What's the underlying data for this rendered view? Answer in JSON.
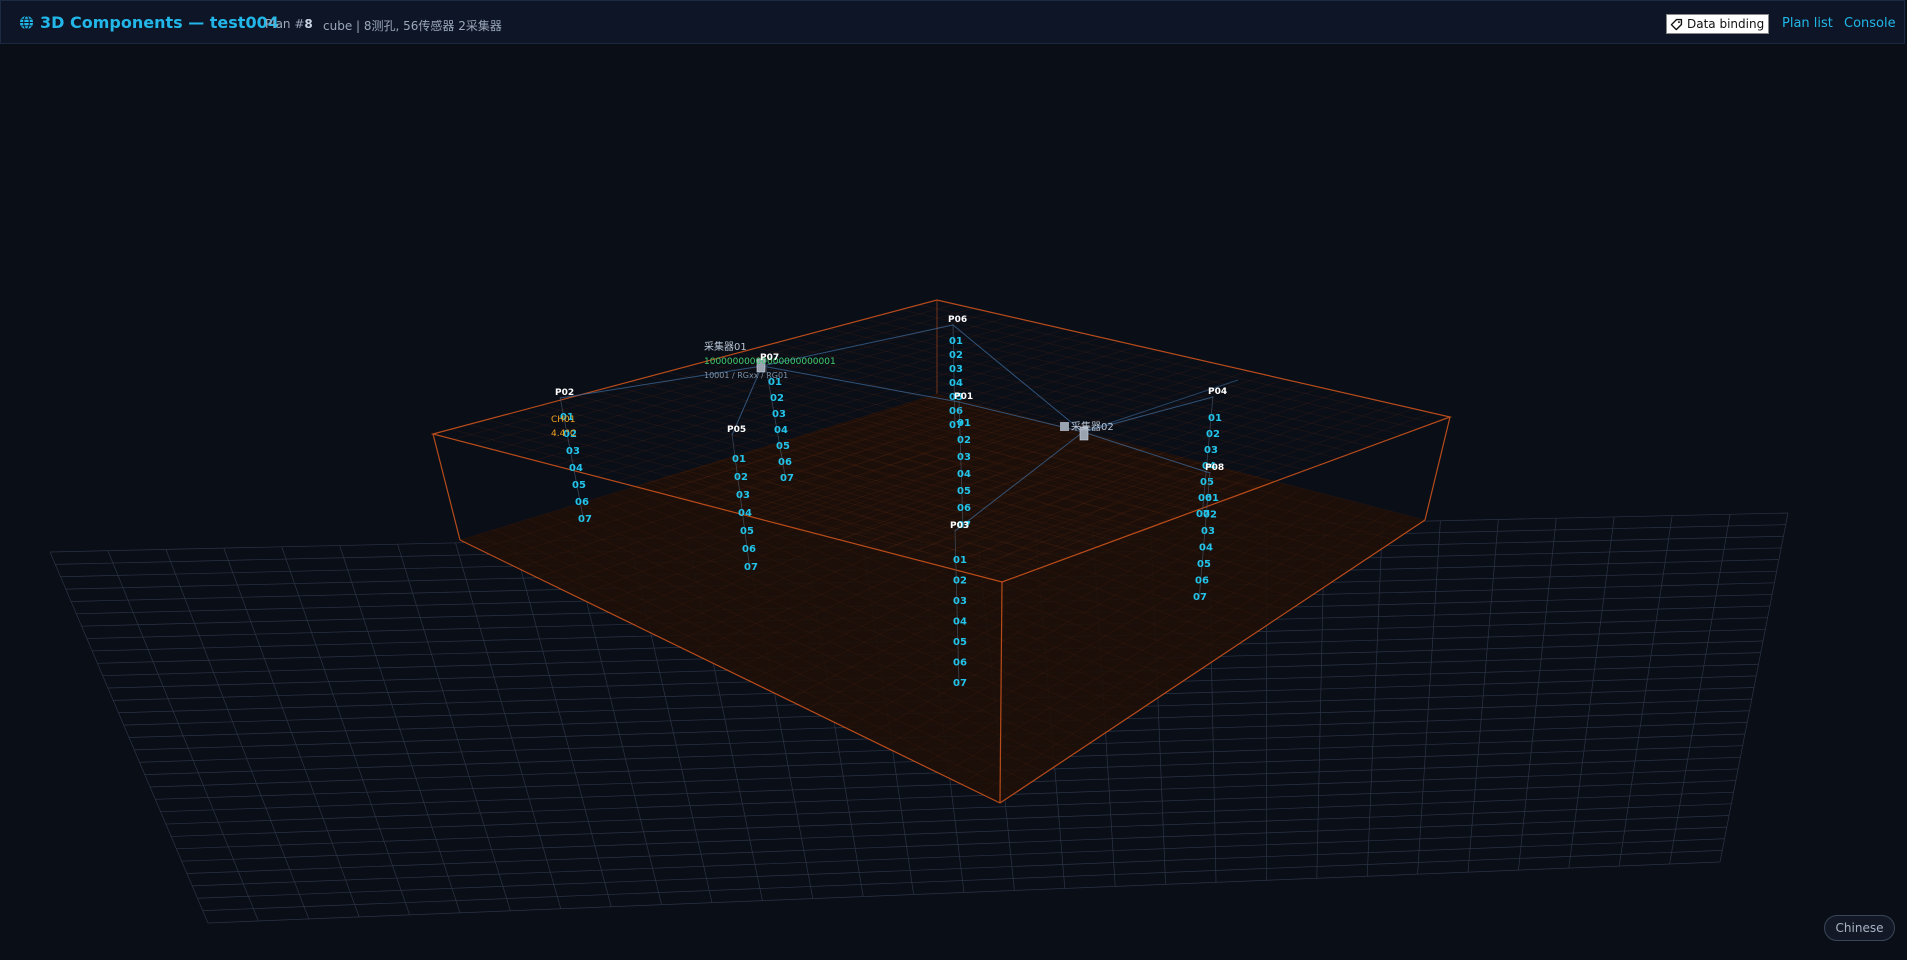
{
  "header": {
    "title": "3D Components — test004",
    "plan_prefix": "Plan #",
    "plan_number": "8",
    "summary": "cube | 8测孔, 56传感器 2采集器"
  },
  "actions": {
    "data_binding": "Data binding",
    "plan_list": "Plan list",
    "console": "Console"
  },
  "language_button": "Chinese",
  "scene": {
    "holes": [
      {
        "name": "P02",
        "sensors": [
          "01",
          "02",
          "03",
          "04",
          "05",
          "06",
          "07"
        ]
      },
      {
        "name": "P05",
        "sensors": [
          "01",
          "02",
          "03",
          "04",
          "05",
          "06",
          "07"
        ]
      },
      {
        "name": "P07",
        "sensors": [
          "01",
          "02",
          "03",
          "04",
          "05",
          "06",
          "07"
        ]
      },
      {
        "name": "P06",
        "sensors": [
          "01",
          "02",
          "03",
          "04",
          "05",
          "06",
          "07"
        ]
      },
      {
        "name": "P01",
        "sensors": [
          "01",
          "02",
          "03",
          "04",
          "05",
          "06",
          "07"
        ]
      },
      {
        "name": "P03",
        "sensors": [
          "01",
          "02",
          "03",
          "04",
          "05",
          "06",
          "07"
        ]
      },
      {
        "name": "P04",
        "sensors": [
          "01",
          "02",
          "03",
          "04",
          "05",
          "06",
          "07"
        ]
      },
      {
        "name": "P08",
        "sensors": [
          "01",
          "02",
          "03",
          "04",
          "05",
          "06",
          "07"
        ]
      }
    ],
    "collectors": [
      {
        "name": "采集器01",
        "serial": "10000000000000000000001",
        "info": "10001 / RGxx / RG01"
      },
      {
        "name": "采集器02"
      }
    ],
    "channel_label": "CH01",
    "temperature": "4.4°C"
  },
  "colors": {
    "background": "#0a0e17",
    "accent": "#22b7e8",
    "box_edge": "#d4561c",
    "sensor_label": "#22c4ea",
    "floor_grid": "#2b3445"
  }
}
